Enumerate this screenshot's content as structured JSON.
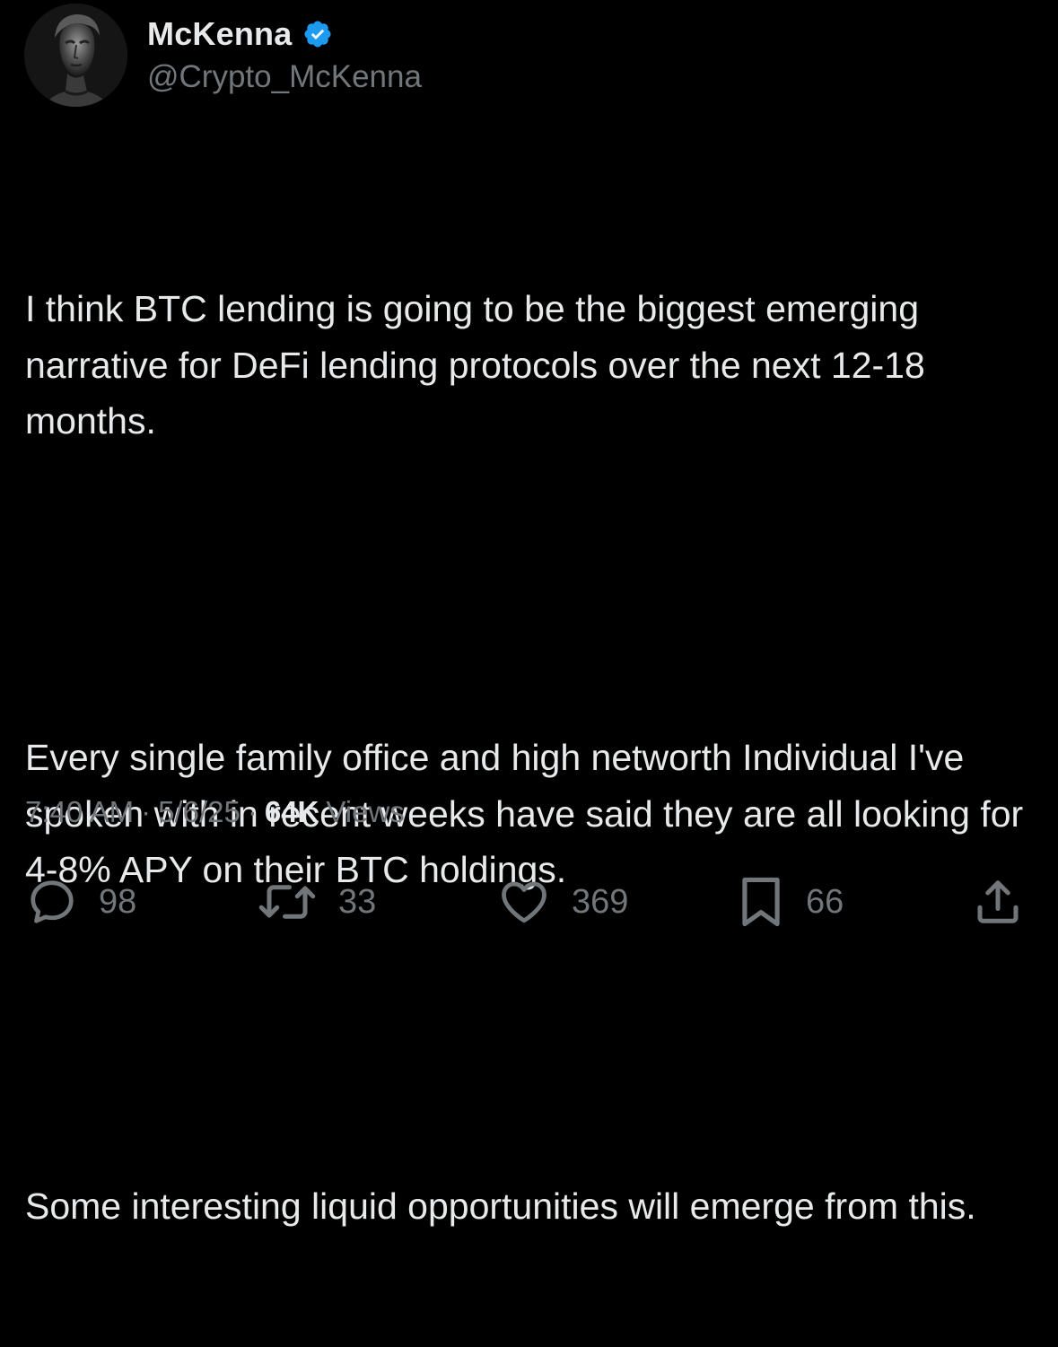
{
  "author": {
    "display_name": "McKenna",
    "handle": "@Crypto_McKenna",
    "verified": true,
    "verified_color": "#1d9bf0",
    "avatar_icon": "statue-portrait-avatar"
  },
  "tweet": {
    "paragraphs": [
      "I think BTC lending is going to be the biggest emerging narrative for DeFi lending protocols over the next 12-18 months.",
      "Every single family office and high networth Individual I've spoken with in recent weeks have said they are all looking for 4-8% APY on their BTC holdings.",
      "Some interesting liquid opportunities will emerge from this."
    ],
    "time": "7:40 AM",
    "separator": "·",
    "date": "5/6/25",
    "views_count": "64K",
    "views_label": "Views"
  },
  "actions": {
    "reply": {
      "icon": "reply-bubble-icon",
      "count": "98"
    },
    "retweet": {
      "icon": "retweet-icon",
      "count": "33"
    },
    "like": {
      "icon": "heart-icon",
      "count": "369"
    },
    "bookmark": {
      "icon": "bookmark-icon",
      "count": "66"
    },
    "share": {
      "icon": "share-icon"
    }
  },
  "colors": {
    "background": "#000000",
    "primary_text": "#e7e9ea",
    "secondary_text": "#71767b"
  }
}
